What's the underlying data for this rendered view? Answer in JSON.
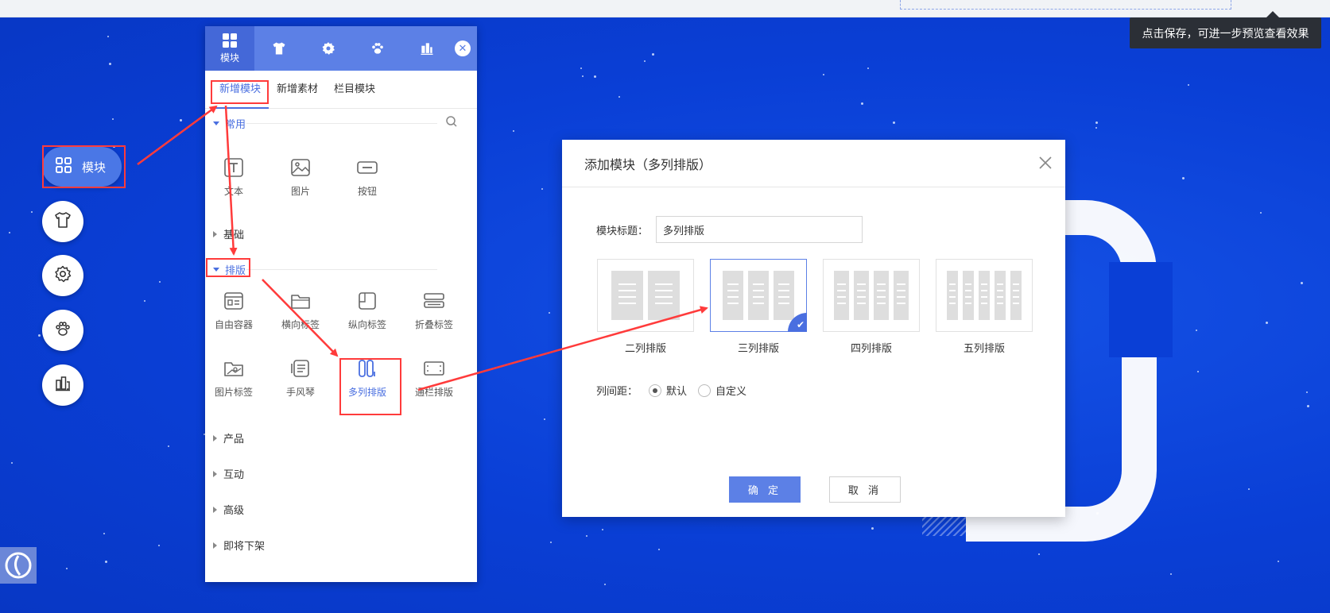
{
  "tooltip": {
    "text": "点击保存，可进一步预览查看效果"
  },
  "float_toolbar": {
    "main_label": "模块",
    "items": [
      "shirt-icon",
      "gear-icon",
      "paw-icon",
      "columns-icon"
    ]
  },
  "panel": {
    "tabs": [
      {
        "label": "模块",
        "icon": "grid-icon"
      },
      {
        "label": "",
        "icon": "shirt-icon"
      },
      {
        "label": "",
        "icon": "gear-icon"
      },
      {
        "label": "",
        "icon": "paw-icon"
      },
      {
        "label": "",
        "icon": "columns-icon"
      }
    ],
    "subtabs": [
      "新增模块",
      "新增素材",
      "栏目模块"
    ],
    "sections": {
      "common": {
        "label": "常用",
        "items": [
          "文本",
          "图片",
          "按钮"
        ]
      },
      "basic": {
        "label": "基础"
      },
      "layout": {
        "label": "排版",
        "items": [
          "自由容器",
          "横向标签",
          "纵向标签",
          "折叠标签",
          "图片标签",
          "手风琴",
          "多列排版",
          "通栏排版"
        ]
      },
      "product": {
        "label": "产品"
      },
      "interaction": {
        "label": "互动"
      },
      "advanced": {
        "label": "高级"
      },
      "deprecated": {
        "label": "即将下架"
      }
    }
  },
  "dialog": {
    "title": "添加模块（多列排版）",
    "title_field_label": "模块标题：",
    "title_field_value": "多列排版",
    "layouts": [
      {
        "label": "二列排版",
        "columns": 2
      },
      {
        "label": "三列排版",
        "columns": 3,
        "selected": true
      },
      {
        "label": "四列排版",
        "columns": 4
      },
      {
        "label": "五列排版",
        "columns": 5
      }
    ],
    "gap_label": "列间距：",
    "gap_options": [
      "默认",
      "自定义"
    ],
    "gap_selected": "默认",
    "ok_label": "确 定",
    "cancel_label": "取 消"
  },
  "colors": {
    "background": "#0a3fd6",
    "accent": "#5c80e6",
    "highlight": "#ff3b3b"
  }
}
